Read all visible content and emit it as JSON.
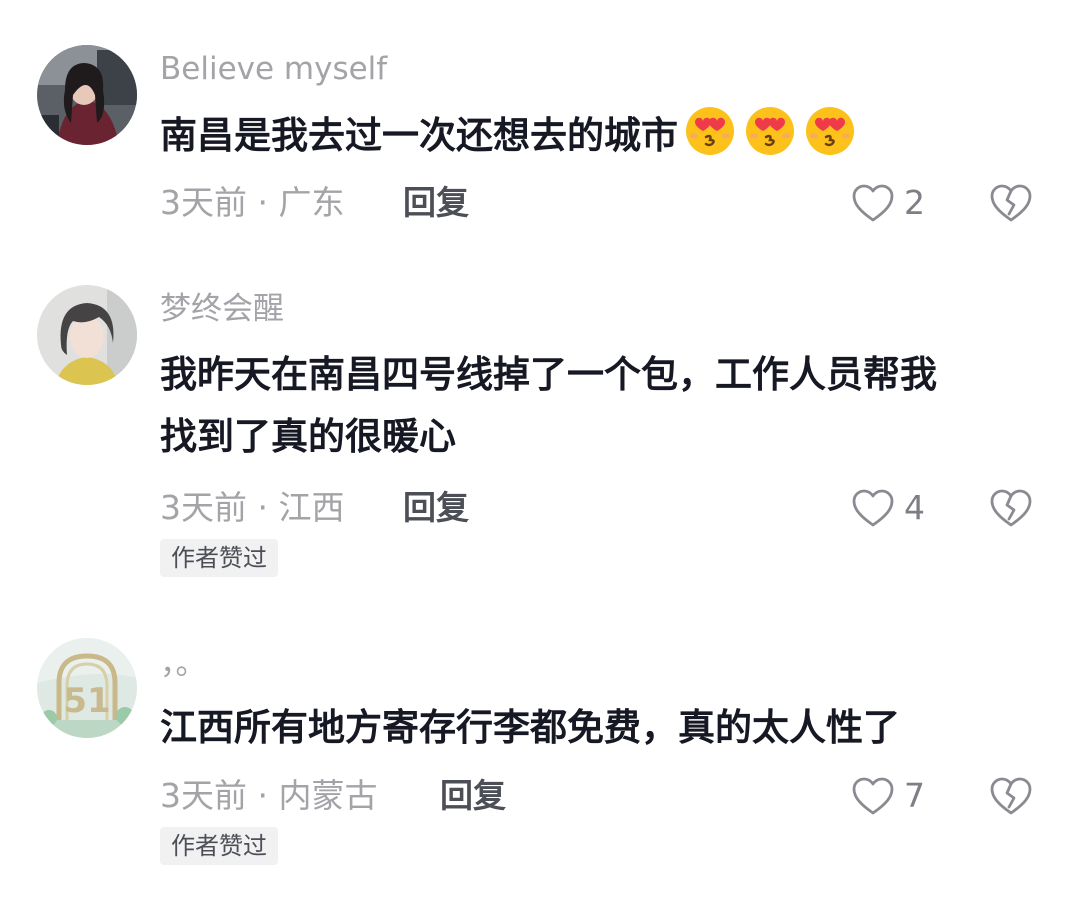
{
  "comments": [
    {
      "username": "Believe myself",
      "text": "南昌是我去过一次还想去的城市",
      "emojis": [
        "heart-eyes-kiss-emoji",
        "heart-eyes-kiss-emoji",
        "heart-eyes-kiss-emoji"
      ],
      "time_location": "3天前 · 广东",
      "reply_label": "回复",
      "likes": "2",
      "badge": ""
    },
    {
      "username": "梦终会醒",
      "text_line1": "我昨天在南昌四号线掉了一个包，工作人员帮我",
      "text_line2": "找到了真的很暖心",
      "time_location": "3天前 · 江西",
      "reply_label": "回复",
      "likes": "4",
      "badge": "作者赞过"
    },
    {
      "username": "，。",
      "text": "江西所有地方寄存行李都免费，真的太人性了",
      "time_location": "3天前 · 内蒙古",
      "reply_label": "回复",
      "likes": "7",
      "badge": "作者赞过"
    }
  ],
  "colors": {
    "username": "#a3a3a8",
    "content": "#161823",
    "meta": "#a3a3a8",
    "reply": "#4d4f57",
    "badge_bg": "#f1f1f2"
  }
}
